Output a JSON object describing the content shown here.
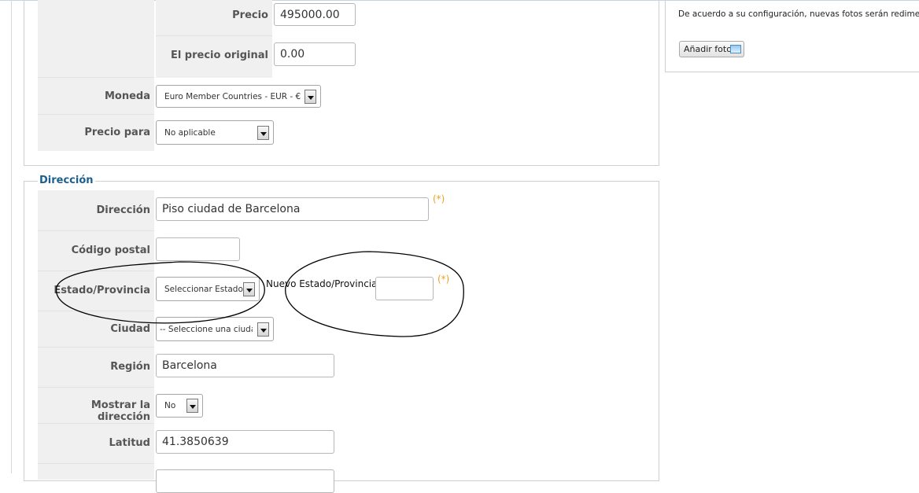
{
  "price_section": {
    "precio": {
      "label": "Precio",
      "value": "495000.00"
    },
    "precio_original": {
      "label": "El precio original",
      "value": "0.00"
    },
    "moneda": {
      "label": "Moneda",
      "selected": "Euro Member Countries - EUR - €"
    },
    "precio_para": {
      "label": "Precio para",
      "selected": "No aplicable"
    }
  },
  "address_section": {
    "legend": "Dirección",
    "required_marker": "(*)",
    "direccion": {
      "label": "Dirección",
      "value": "Piso ciudad de Barcelona"
    },
    "codigo_postal": {
      "label": "Código postal",
      "value": ""
    },
    "estado": {
      "label": "Estado/Provincia",
      "selected": "Seleccionar Estado",
      "new_label": "Nuevo Estado/Provincia:",
      "new_value": ""
    },
    "ciudad": {
      "label": "Ciudad",
      "selected": "-- Seleccione una ciudad --"
    },
    "region": {
      "label": "Región",
      "value": "Barcelona"
    },
    "mostrar": {
      "label": "Mostrar la dirección",
      "selected": "No"
    },
    "latitud": {
      "label": "Latitud",
      "value": "41.3850639"
    }
  },
  "photos_panel": {
    "note": "De acuerdo a su configuración, nuevas fotos serán redimensionadas",
    "add_button": "Añadir foto",
    "add_icon": "image-icon"
  }
}
